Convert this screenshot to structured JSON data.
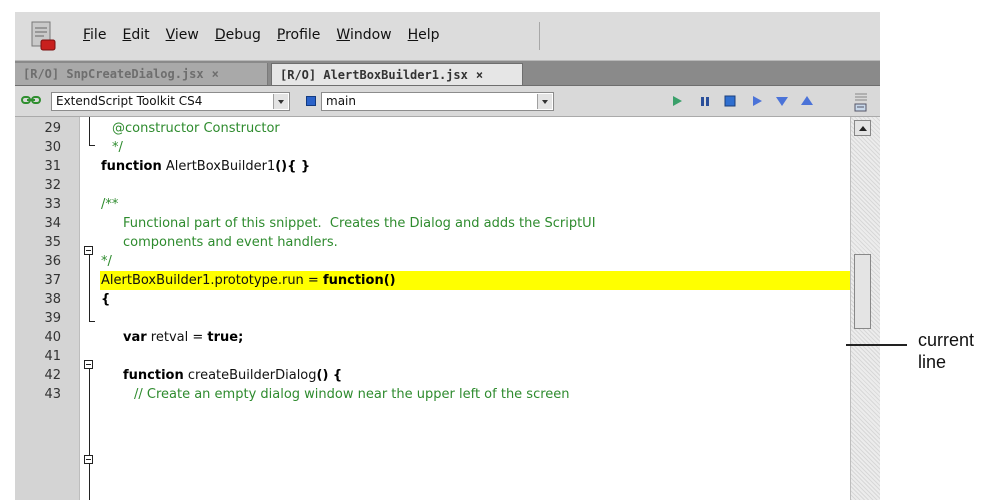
{
  "menu": {
    "items": [
      {
        "key": "F",
        "rest": "ile"
      },
      {
        "key": "E",
        "rest": "dit"
      },
      {
        "key": "V",
        "rest": "iew"
      },
      {
        "key": "D",
        "rest": "ebug"
      },
      {
        "key": "P",
        "rest": "rofile"
      },
      {
        "key": "W",
        "rest": "indow"
      },
      {
        "key": "H",
        "rest": "elp"
      }
    ]
  },
  "tabs": [
    {
      "label": "[R/O] SnpCreateDialog.jsx",
      "close": "×"
    },
    {
      "label": "[R/O] AlertBoxBuilder1.jsx",
      "close": "×"
    }
  ],
  "toolbar": {
    "target": "ExtendScript Toolkit CS4",
    "engine": "main"
  },
  "icons": {
    "logo": "app-logo-icon",
    "link": "link-icon",
    "run": "play-icon",
    "pause": "pause-icon",
    "stop": "stop-icon",
    "step_over": "step-over-icon",
    "step_into": "step-into-icon",
    "step_out": "step-out-icon",
    "panel_menu": "panel-menu-icon"
  },
  "editor": {
    "lines": [
      {
        "num": "29",
        "parts": [
          {
            "t": "@constructor Constructor",
            "c": "comment"
          }
        ],
        "indent": 1
      },
      {
        "num": "30",
        "parts": [
          {
            "t": "*/",
            "c": "comment"
          }
        ],
        "indent": 1
      },
      {
        "num": "31",
        "parts": [
          {
            "t": "function",
            "c": "kw"
          },
          {
            "t": " AlertBoxBuilder1",
            "c": ""
          },
          {
            "t": "(){ }",
            "c": "kw"
          }
        ],
        "indent": 0
      },
      {
        "num": "32",
        "parts": [],
        "indent": 0
      },
      {
        "num": "33",
        "parts": [
          {
            "t": "/**",
            "c": "comment"
          }
        ],
        "indent": 0
      },
      {
        "num": "34",
        "parts": [
          {
            "t": "Functional part of this snippet.  Creates the Dialog and adds the ScriptUI",
            "c": "comment"
          }
        ],
        "indent": 2
      },
      {
        "num": "35",
        "parts": [
          {
            "t": "components and event handlers.",
            "c": "comment"
          }
        ],
        "indent": 2
      },
      {
        "num": "36",
        "parts": [
          {
            "t": "*/",
            "c": "comment"
          }
        ],
        "indent": 0
      },
      {
        "num": "37",
        "parts": [
          {
            "t": "AlertBoxBuilder1.prototype.run = ",
            "c": ""
          },
          {
            "t": "function()",
            "c": "kw"
          }
        ],
        "indent": 0,
        "current": true
      },
      {
        "num": "38",
        "parts": [
          {
            "t": "{",
            "c": "kw"
          }
        ],
        "indent": 0
      },
      {
        "num": "39",
        "parts": [],
        "indent": 0
      },
      {
        "num": "40",
        "parts": [
          {
            "t": "var",
            "c": "kw"
          },
          {
            "t": " retval = ",
            "c": ""
          },
          {
            "t": "true;",
            "c": "kw"
          }
        ],
        "indent": 2
      },
      {
        "num": "41",
        "parts": [],
        "indent": 0
      },
      {
        "num": "42",
        "parts": [
          {
            "t": "function",
            "c": "kw"
          },
          {
            "t": " createBuilderDialog",
            "c": ""
          },
          {
            "t": "() {",
            "c": "kw"
          }
        ],
        "indent": 2
      },
      {
        "num": "43",
        "parts": [
          {
            "t": "// Create an empty dialog window near the upper left of the screen",
            "c": "comment"
          }
        ],
        "indent": 3
      }
    ]
  },
  "annotation": {
    "line1": "current",
    "line2": "line"
  }
}
